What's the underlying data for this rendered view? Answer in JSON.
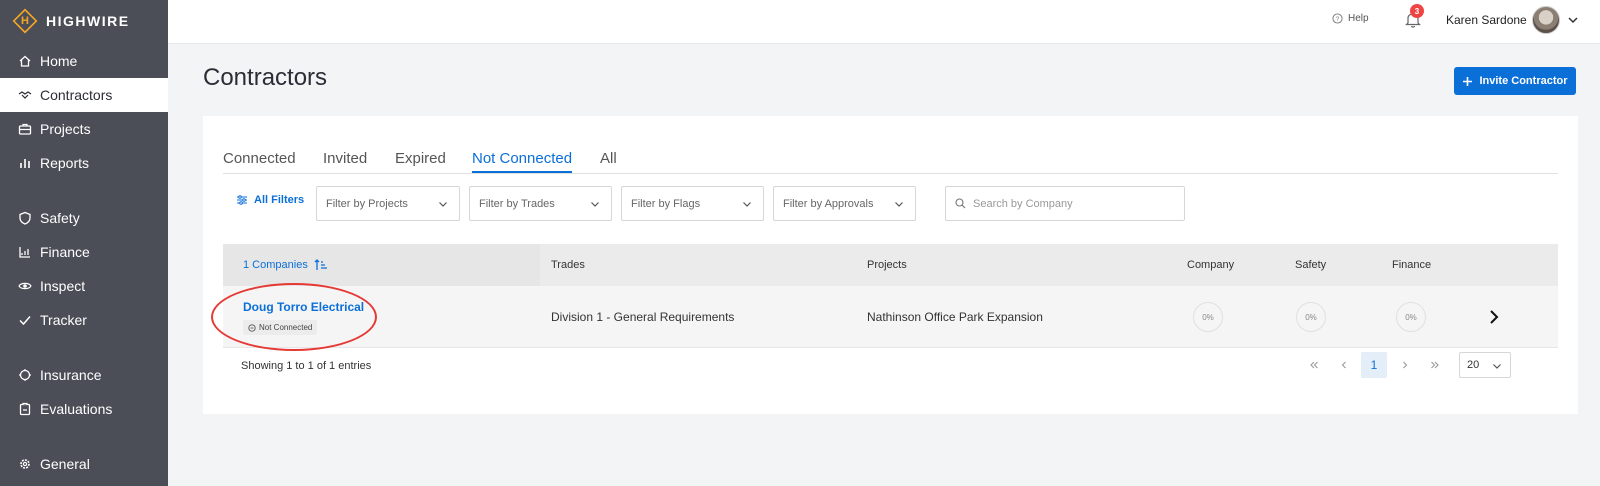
{
  "app": {
    "name": "HIGHWIRE",
    "logo_letter": "H"
  },
  "sidebar": {
    "items": [
      {
        "label": "Home",
        "icon": "home-icon"
      },
      {
        "label": "Contractors",
        "icon": "handshake-icon",
        "active": true
      },
      {
        "label": "Projects",
        "icon": "briefcase-icon"
      },
      {
        "label": "Reports",
        "icon": "bar-chart-icon"
      },
      {
        "label": "Safety",
        "icon": "shield-icon"
      },
      {
        "label": "Finance",
        "icon": "finance-chart-icon"
      },
      {
        "label": "Inspect",
        "icon": "eye-icon"
      },
      {
        "label": "Tracker",
        "icon": "check-icon"
      },
      {
        "label": "Insurance",
        "icon": "umbrella-icon"
      },
      {
        "label": "Evaluations",
        "icon": "clipboard-icon"
      },
      {
        "label": "General",
        "icon": "gear-icon"
      }
    ]
  },
  "topbar": {
    "help_label": "Help",
    "notification_count": "3",
    "user_name": "Karen Sardone"
  },
  "page": {
    "title": "Contractors",
    "invite_button": "Invite Contractor"
  },
  "tabs": [
    {
      "label": "Connected"
    },
    {
      "label": "Invited"
    },
    {
      "label": "Expired"
    },
    {
      "label": "Not Connected",
      "active": true
    },
    {
      "label": "All"
    }
  ],
  "filters": {
    "all_filters_label": "All Filters",
    "projects": "Filter by Projects",
    "trades": "Filter by Trades",
    "flags": "Filter by Flags",
    "approvals": "Filter by Approvals",
    "search_placeholder": "Search by Company"
  },
  "table": {
    "columns": {
      "companies": "1 Companies",
      "trades": "Trades",
      "projects": "Projects",
      "company": "Company",
      "safety": "Safety",
      "finance": "Finance"
    },
    "rows": [
      {
        "company_name": "Doug Torro Electrical",
        "status": "Not Connected",
        "trades": "Division 1 - General Requirements",
        "projects": "Nathinson Office Park Expansion",
        "company_score": "0%",
        "safety_score": "0%",
        "finance_score": "0%"
      }
    ]
  },
  "pagination": {
    "showing_text": "Showing 1 to 1 of 1 entries",
    "current_page": "1",
    "page_size": "20"
  },
  "colors": {
    "accent": "#0b6fd8",
    "sidebar": "#4b4d57",
    "badge": "#ef4444",
    "annotation": "#e53935"
  }
}
